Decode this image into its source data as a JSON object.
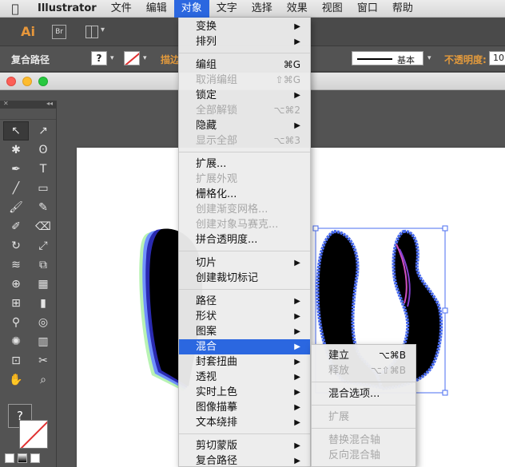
{
  "menubar": {
    "app_name": "Illustrator",
    "items": [
      "文件",
      "编辑",
      "对象",
      "文字",
      "选择",
      "效果",
      "视图",
      "窗口",
      "帮助"
    ],
    "active_index": 2
  },
  "appbar": {
    "logo": "Ai",
    "bridge": "Br"
  },
  "control": {
    "selection_label": "复合路径",
    "fill_swatch": "?",
    "stroke_label": "描边",
    "stroke_style_label": "基本",
    "opacity_label": "不透明度:",
    "opacity_value": "10"
  },
  "object_menu": {
    "items": [
      {
        "label": "变换",
        "submenu": true
      },
      {
        "label": "排列",
        "submenu": true
      },
      {
        "separator": true
      },
      {
        "label": "编组",
        "shortcut": "⌘G"
      },
      {
        "label": "取消编组",
        "shortcut": "⇧⌘G",
        "disabled": true
      },
      {
        "label": "锁定",
        "submenu": true
      },
      {
        "label": "全部解锁",
        "shortcut": "⌥⌘2",
        "disabled": true
      },
      {
        "label": "隐藏",
        "submenu": true
      },
      {
        "label": "显示全部",
        "shortcut": "⌥⌘3",
        "disabled": true
      },
      {
        "separator": true
      },
      {
        "label": "扩展..."
      },
      {
        "label": "扩展外观",
        "disabled": true
      },
      {
        "label": "栅格化..."
      },
      {
        "label": "创建渐变网格...",
        "disabled": true
      },
      {
        "label": "创建对象马赛克...",
        "disabled": true
      },
      {
        "label": "拼合透明度..."
      },
      {
        "separator": true
      },
      {
        "label": "切片",
        "submenu": true
      },
      {
        "label": "创建裁切标记"
      },
      {
        "separator": true
      },
      {
        "label": "路径",
        "submenu": true
      },
      {
        "label": "形状",
        "submenu": true
      },
      {
        "label": "图案",
        "submenu": true
      },
      {
        "label": "混合",
        "submenu": true,
        "highlighted": true
      },
      {
        "label": "封套扭曲",
        "submenu": true
      },
      {
        "label": "透视",
        "submenu": true
      },
      {
        "label": "实时上色",
        "submenu": true
      },
      {
        "label": "图像描摹",
        "submenu": true
      },
      {
        "label": "文本绕排",
        "submenu": true
      },
      {
        "separator": true
      },
      {
        "label": "剪切蒙版",
        "submenu": true
      },
      {
        "label": "复合路径",
        "submenu": true
      }
    ]
  },
  "blend_submenu": {
    "items": [
      {
        "label": "建立",
        "shortcut": "⌥⌘B"
      },
      {
        "label": "释放",
        "shortcut": "⌥⇧⌘B",
        "disabled": true
      },
      {
        "separator": true
      },
      {
        "label": "混合选项..."
      },
      {
        "separator": true
      },
      {
        "label": "扩展",
        "disabled": true
      },
      {
        "separator": true
      },
      {
        "label": "替换混合轴",
        "disabled": true
      },
      {
        "label": "反向混合轴",
        "disabled": true
      }
    ]
  },
  "colors": {
    "accent": "#2b67e0",
    "selection_path": "#4a6cf0",
    "highlight_text": "#ffffff"
  }
}
